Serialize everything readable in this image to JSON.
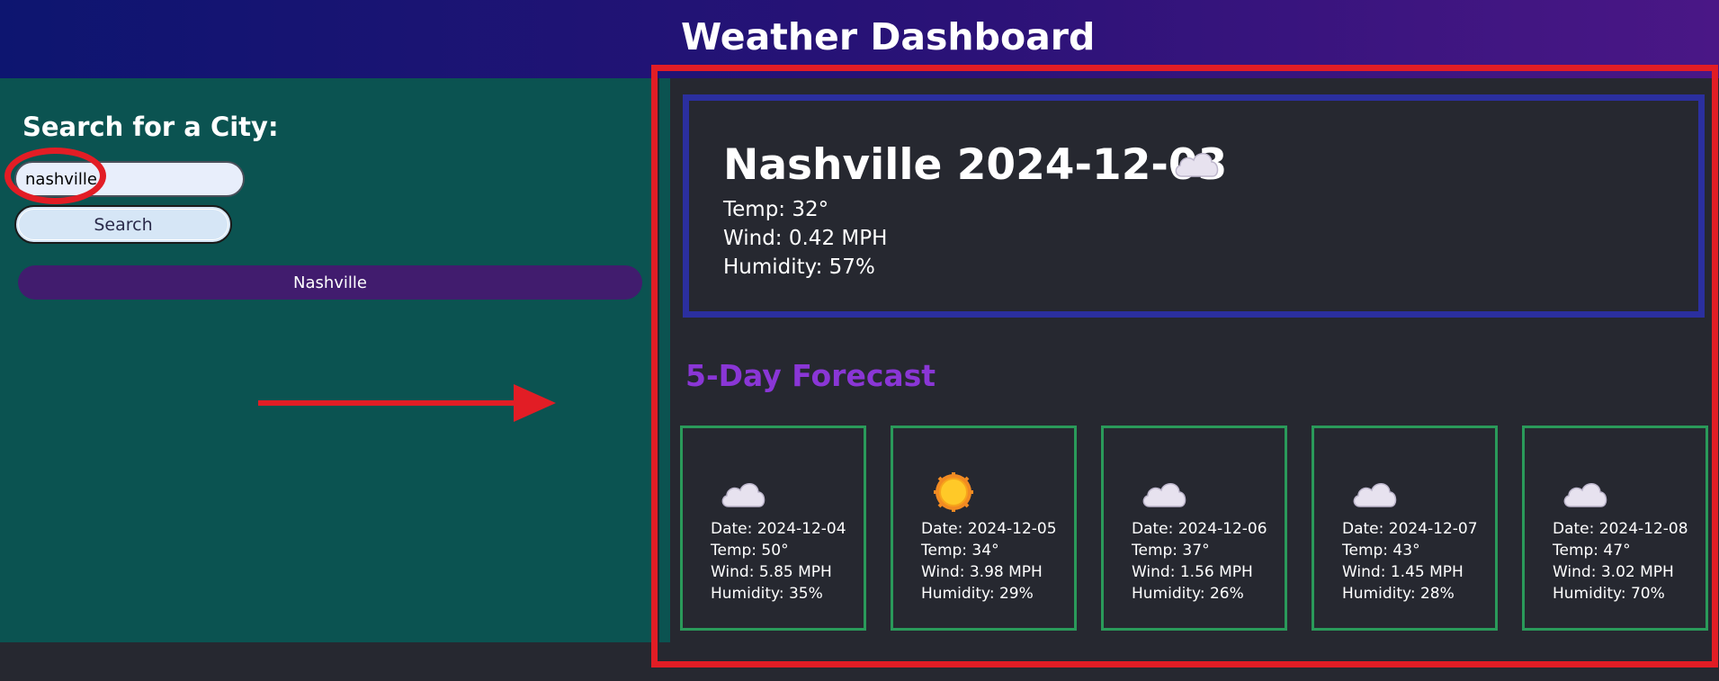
{
  "header": {
    "title": "Weather Dashboard"
  },
  "sidebar": {
    "heading": "Search for a City:",
    "search_value": "nashville",
    "search_button": "Search",
    "history": [
      "Nashville"
    ]
  },
  "current": {
    "city_date": "Nashville 2024-12-03",
    "icon": "cloud-icon",
    "temp": "Temp: 32°",
    "wind": "Wind: 0.42 MPH",
    "humidity": "Humidity: 57%"
  },
  "forecast": {
    "heading": "5-Day Forecast",
    "days": [
      {
        "icon": "cloud-icon",
        "date": "Date: 2024-12-04",
        "temp": "Temp: 50°",
        "wind": "Wind: 5.85 MPH",
        "humidity": "Humidity: 35%"
      },
      {
        "icon": "sun-icon",
        "date": "Date: 2024-12-05",
        "temp": "Temp: 34°",
        "wind": "Wind: 3.98 MPH",
        "humidity": "Humidity: 29%"
      },
      {
        "icon": "cloud-icon",
        "date": "Date: 2024-12-06",
        "temp": "Temp: 37°",
        "wind": "Wind: 1.56 MPH",
        "humidity": "Humidity: 26%"
      },
      {
        "icon": "cloud-icon",
        "date": "Date: 2024-12-07",
        "temp": "Temp: 43°",
        "wind": "Wind: 1.45 MPH",
        "humidity": "Humidity: 28%"
      },
      {
        "icon": "cloud-icon",
        "date": "Date: 2024-12-08",
        "temp": "Temp: 47°",
        "wind": "Wind: 3.02 MPH",
        "humidity": "Humidity: 70%"
      }
    ]
  },
  "colors": {
    "header_start": "#0d1570",
    "header_end": "#4a1786",
    "sidebar_bg": "#0b5351",
    "main_bg": "#262830",
    "current_border": "#2b2f9f",
    "forecast_heading": "#8a36d6",
    "card_border": "#2a9a5a",
    "history_button": "#411c6e",
    "annotation": "#e21d25"
  }
}
